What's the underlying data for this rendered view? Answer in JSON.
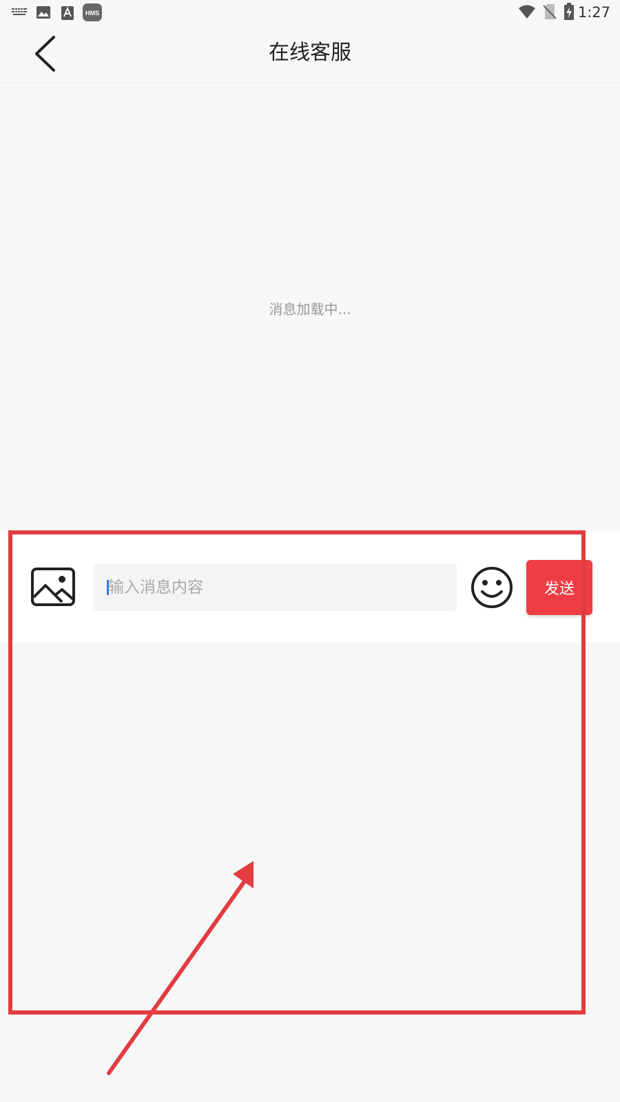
{
  "status_bar": {
    "time": "1:27",
    "left_icons": [
      "keyboard-icon",
      "gallery-icon",
      "font-a-icon",
      "hms-icon"
    ],
    "hms_label": "HMS",
    "right_icons": [
      "wifi-icon",
      "no-sim-icon",
      "battery-charging-icon"
    ]
  },
  "header": {
    "title": "在线客服",
    "back_icon": "chevron-left-icon"
  },
  "messages": {
    "loading_text": "消息加载中..."
  },
  "composer": {
    "image_icon": "image-icon",
    "input_placeholder": "输入消息内容",
    "input_value": "",
    "emoji_icon": "smiley-icon",
    "send_label": "发送"
  },
  "colors": {
    "accent": "#ee3e44",
    "background": "#f6f7f7",
    "toolbar": "#ffffff",
    "caret": "#2b7de9",
    "annotation": "#e23c41"
  },
  "annotation": {
    "shapes": [
      "highlight-rectangle",
      "pointer-arrow"
    ]
  }
}
